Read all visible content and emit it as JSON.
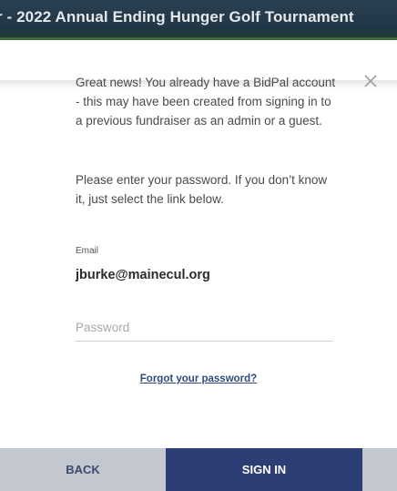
{
  "header": {
    "title": "r - 2022 Annual Ending Hunger Golf Tournament"
  },
  "dialog": {
    "message_1": "Great news! You already have a BidPal account - this may have been created from signing in to a previous fundraiser as an admin or a guest.",
    "message_2": "Please enter your password. If you don’t know it, just select the link below.",
    "email_label": "Email",
    "email_value": "jburke@mainecul.org",
    "password_placeholder": "Password",
    "forgot_link": "Forgot your password?",
    "back_label": "BACK",
    "signin_label": "SIGN IN",
    "close_icon": "close-icon"
  },
  "colors": {
    "primary": "#2c3e73",
    "secondary": "#c3c8d0",
    "link": "#2f4a80",
    "banner": "#213646"
  }
}
